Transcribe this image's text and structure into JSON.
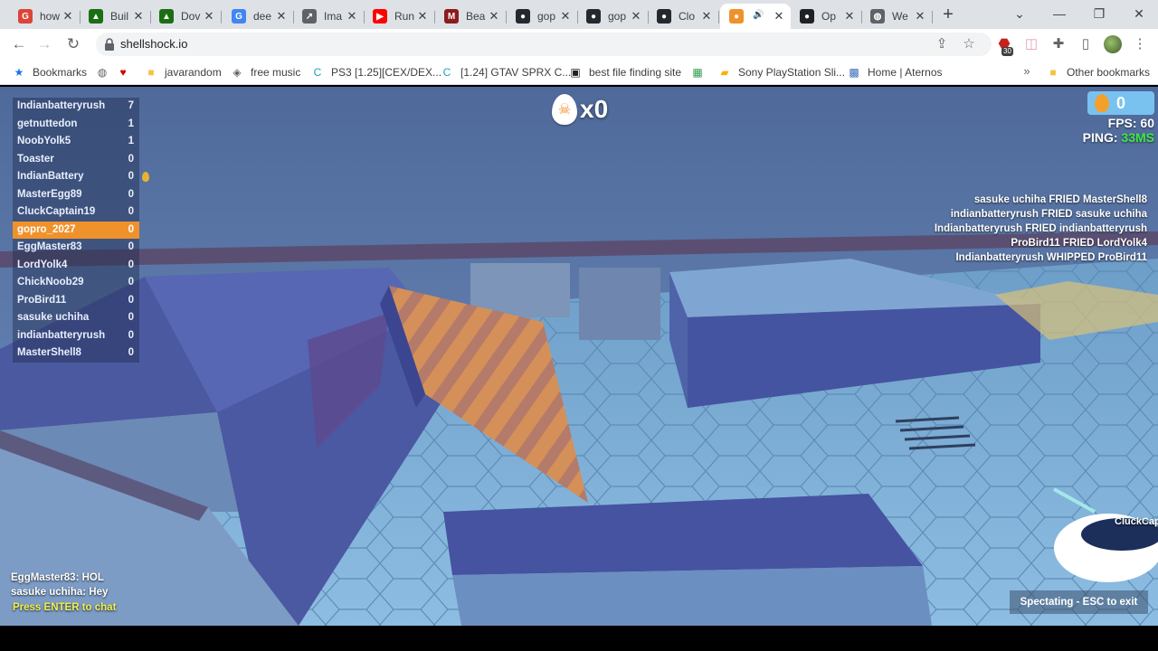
{
  "browser": {
    "tabs": [
      {
        "label": "how",
        "fav_color": "#db4437",
        "fav_glyph": "G"
      },
      {
        "label": "Buil",
        "fav_color": "#1b6e12",
        "fav_glyph": "▲"
      },
      {
        "label": "Dov",
        "fav_color": "#1b6e12",
        "fav_glyph": "▲"
      },
      {
        "label": "dee",
        "fav_color": "#4285f4",
        "fav_glyph": "G"
      },
      {
        "label": "Ima",
        "fav_color": "#5f6368",
        "fav_glyph": "↗"
      },
      {
        "label": "Run",
        "fav_color": "#ff0000",
        "fav_glyph": "▶"
      },
      {
        "label": "Bea",
        "fav_color": "#8b1c1c",
        "fav_glyph": "M"
      },
      {
        "label": "gop",
        "fav_color": "#24292e",
        "fav_glyph": "●"
      },
      {
        "label": "gop",
        "fav_color": "#24292e",
        "fav_glyph": "●"
      },
      {
        "label": "Clo",
        "fav_color": "#24292e",
        "fav_glyph": "●"
      },
      {
        "label": "",
        "fav_color": "#f0922b",
        "fav_glyph": "●",
        "active": true
      },
      {
        "label": "Op",
        "fav_color": "#202124",
        "fav_glyph": "●"
      },
      {
        "label": "We",
        "fav_color": "#5f6368",
        "fav_glyph": "◍"
      }
    ],
    "url": "shellshock.io",
    "extension_badge": "30",
    "bookmarks": [
      {
        "label": "Bookmarks",
        "icon": "star-icon",
        "color": "#1a73e8"
      },
      {
        "label": "",
        "icon": "globe-icon",
        "color": "#5f6368"
      },
      {
        "label": "",
        "icon": "heart-icon",
        "color": "#d40000"
      },
      {
        "label": "javarandom",
        "icon": "folder-icon",
        "color": "#f6c445"
      },
      {
        "label": "free music",
        "icon": "alien-icon",
        "color": "#5f6368"
      },
      {
        "label": "PS3 [1.25][CEX/DEX...",
        "icon": "c-icon",
        "color": "#1aa3c9"
      },
      {
        "label": "[1.24] GTAV SPRX C...",
        "icon": "c-icon",
        "color": "#1aa3c9"
      },
      {
        "label": "best file finding site",
        "icon": "briefcase-icon",
        "color": "#202124"
      },
      {
        "label": "",
        "icon": "app-icon",
        "color": "#2e9e4f"
      },
      {
        "label": "Sony PlayStation Sli...",
        "icon": "bag-icon",
        "color": "#f4b400"
      },
      {
        "label": "Home | Aternos",
        "icon": "grid-icon",
        "color": "#3a6fb5"
      },
      {
        "label": "Other bookmarks",
        "icon": "folder-icon",
        "color": "#f6c445"
      }
    ]
  },
  "game": {
    "scoreboard": [
      {
        "name": "Indianbatteryrush",
        "score": "7"
      },
      {
        "name": "getnuttedon",
        "score": "1"
      },
      {
        "name": "NoobYolk5",
        "score": "1"
      },
      {
        "name": "Toaster",
        "score": "0"
      },
      {
        "name": "IndianBattery",
        "score": "0"
      },
      {
        "name": "MasterEgg89",
        "score": "0"
      },
      {
        "name": "CluckCaptain19",
        "score": "0"
      },
      {
        "name": "gopro_2027",
        "score": "0",
        "me": true
      },
      {
        "name": "EggMaster83",
        "score": "0"
      },
      {
        "name": "LordYolk4",
        "score": "0"
      },
      {
        "name": "ChickNoob29",
        "score": "0"
      },
      {
        "name": "ProBird11",
        "score": "0"
      },
      {
        "name": "sasuke uchiha",
        "score": "0"
      },
      {
        "name": "indianbatteryrush",
        "score": "0"
      },
      {
        "name": "MasterShell8",
        "score": "0"
      }
    ],
    "kill_streak": "x0",
    "eggs": "0",
    "fps_label": "FPS:",
    "fps_value": "60",
    "ping_label": "PING:",
    "ping_value": "33MS",
    "killfeed": [
      "sasuke uchiha FRIED MasterShell8",
      "indianbatteryrush FRIED sasuke uchiha",
      "Indianbatteryrush FRIED indianbatteryrush",
      "ProBird11 FRIED LordYolk4",
      "Indianbatteryrush WHIPPED ProBird11"
    ],
    "chat": [
      "EggMaster83: HOL",
      "sasuke uchiha: Hey"
    ],
    "chat_prompt": "Press ENTER to chat",
    "spectating": "Spectating - ESC to exit",
    "player_tag": "CluckCap"
  }
}
